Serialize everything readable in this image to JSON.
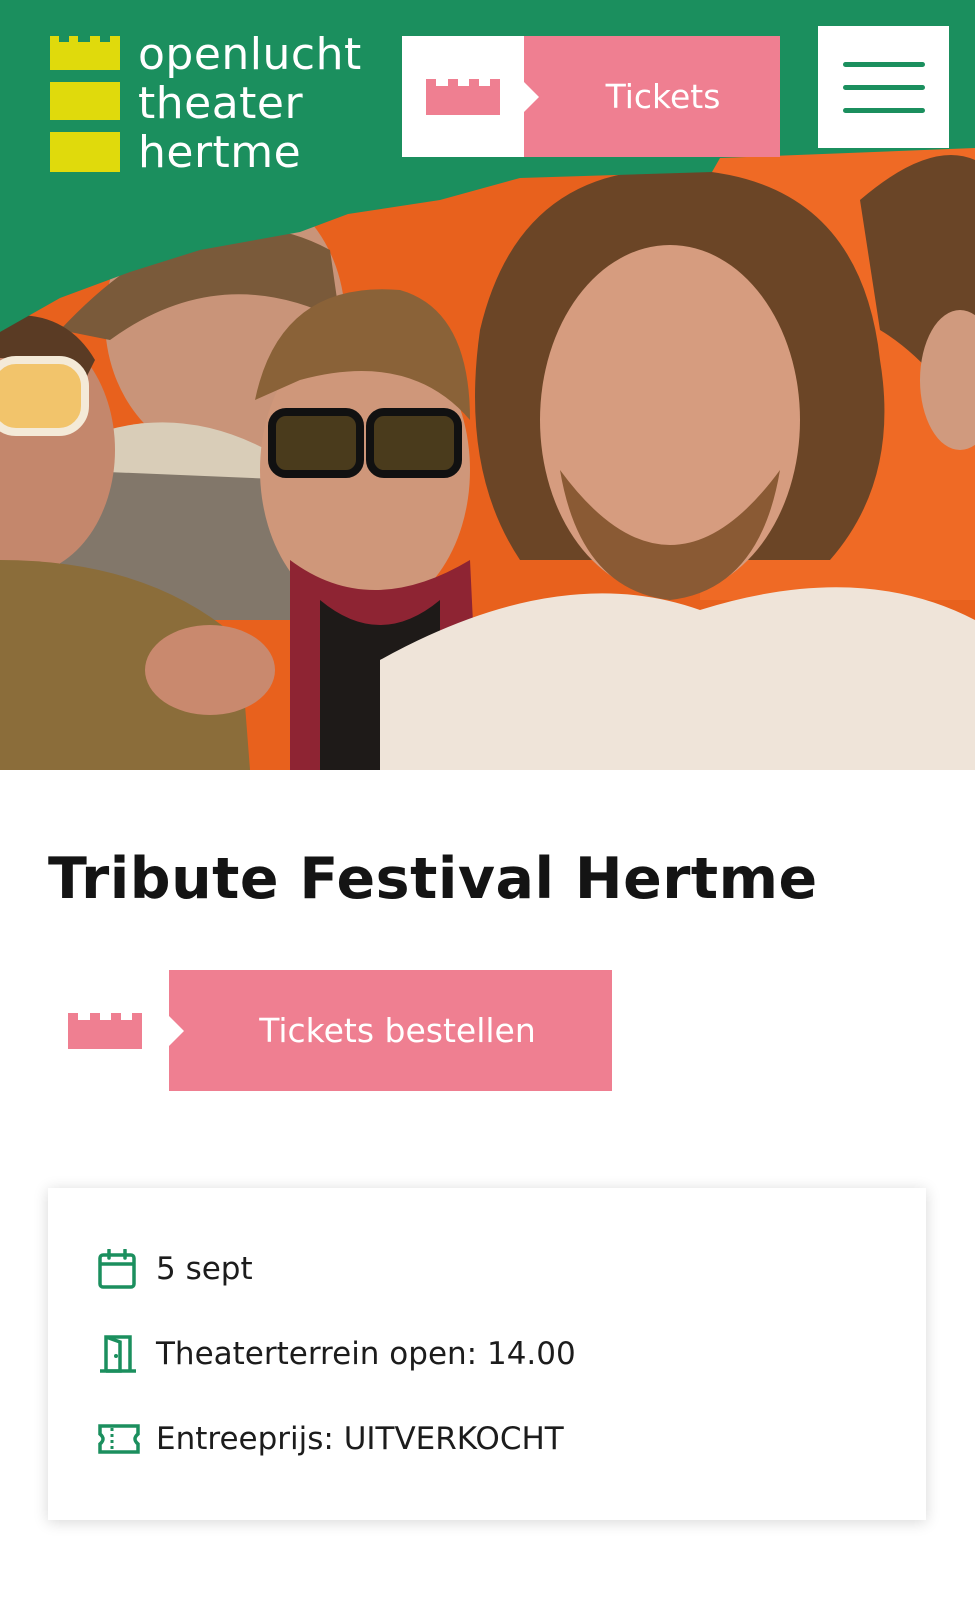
{
  "brand": {
    "logo_line1": "openlucht",
    "logo_line2": "theater",
    "logo_line3": "hertme",
    "green": "#1b8f5e",
    "pink": "#ef7f91",
    "yellow": "#e0da0c",
    "orange": "#e8611d"
  },
  "header": {
    "tickets_label": "Tickets",
    "menu_icon": "hamburger-menu-icon",
    "tickets_icon": "castle-icon"
  },
  "hero": {
    "image": "band-photo"
  },
  "event": {
    "title": "Tribute Festival Hertme",
    "order_button_label": "Tickets bestellen"
  },
  "info": {
    "date": "5 sept",
    "gates_open": "Theaterterrein open: 14.00",
    "price": "Entreeprijs: UITVERKOCHT",
    "icons": [
      "calendar-icon",
      "door-icon",
      "ticket-icon"
    ]
  }
}
